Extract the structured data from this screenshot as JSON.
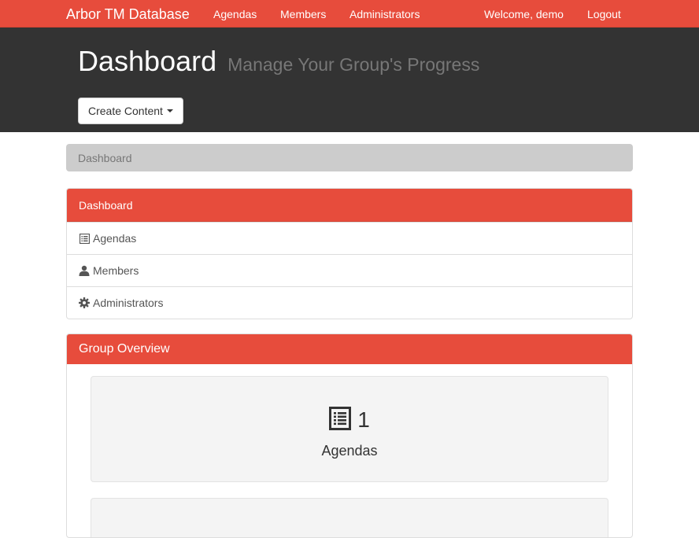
{
  "brand": "Arbor TM Database",
  "nav": {
    "agendas": "Agendas",
    "members": "Members",
    "administrators": "Administrators",
    "welcome": "Welcome, demo",
    "logout": "Logout"
  },
  "header": {
    "title": "Dashboard",
    "subtitle": "Manage Your Group's Progress",
    "create_button": "Create Content"
  },
  "breadcrumb": "Dashboard",
  "menu": {
    "heading": "Dashboard",
    "items": [
      {
        "label": "Agendas",
        "icon": "list-icon"
      },
      {
        "label": "Members",
        "icon": "user-icon"
      },
      {
        "label": "Administrators",
        "icon": "gear-icon"
      }
    ]
  },
  "overview": {
    "heading": "Group Overview",
    "stats": [
      {
        "count": "1",
        "label": "Agendas",
        "icon": "list-icon"
      }
    ]
  },
  "colors": {
    "accent": "#e74c3c",
    "header_bg": "#333333",
    "breadcrumb_bg": "#cccccc"
  }
}
